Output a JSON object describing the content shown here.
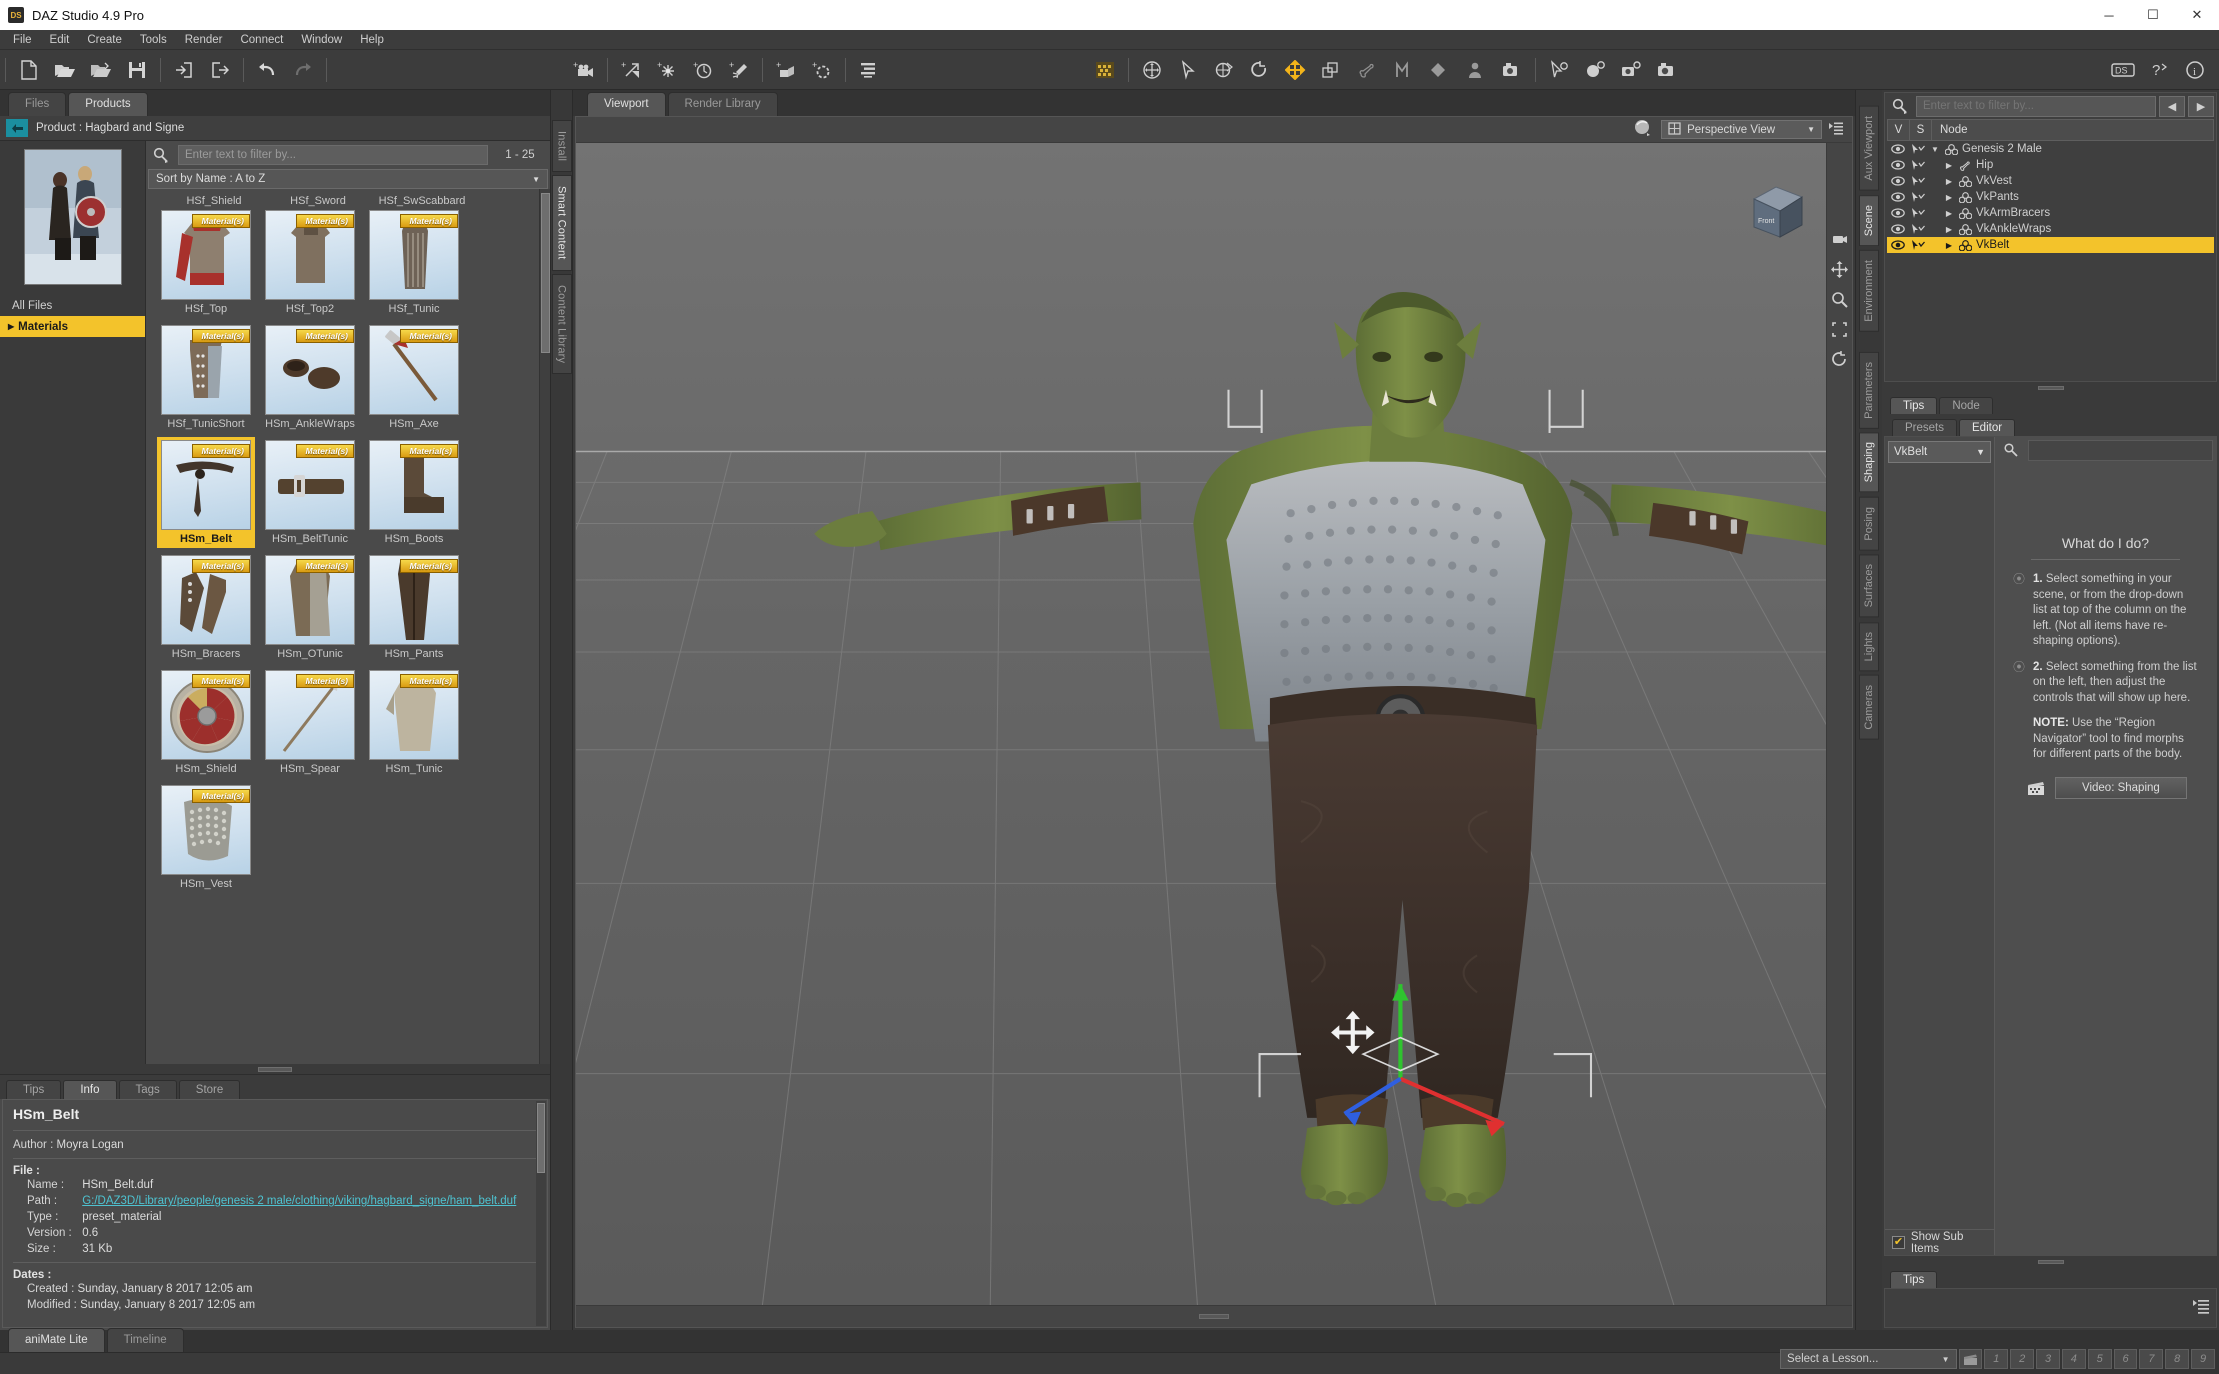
{
  "window": {
    "title": "DAZ Studio 4.9 Pro",
    "logo": "DS",
    "minimize": "─",
    "maximize": "☐",
    "close": "✕"
  },
  "menu": [
    "File",
    "Edit",
    "Create",
    "Tools",
    "Render",
    "Connect",
    "Window",
    "Help"
  ],
  "toolbar": {
    "left_icons": [
      "new-document-icon",
      "open-folder-icon",
      "open-recent-icon",
      "save-icon",
      "import-icon",
      "export-icon",
      "undo-icon",
      "redo-icon"
    ],
    "create_icons": [
      "add-camera-icon",
      "add-distant-light-icon",
      "add-point-light-icon",
      "add-spotlight-icon",
      "add-light-icon",
      "add-primitive-icon",
      "add-null-icon",
      "scene-list-icon"
    ],
    "tool_icons": [
      "texture-grid-icon",
      "universal-tool-icon",
      "node-selection-icon",
      "rotate-tool-icon",
      "translate-tool-icon",
      "active-pose-icon",
      "scale-tool-icon",
      "bone-tool-icon",
      "mesh-grabber-icon",
      "surface-selection-icon",
      "puppeteer-icon",
      "render-camera-icon",
      "cursor-settings-icon",
      "render-settings-icon",
      "camera-settings-icon",
      "render-icon"
    ],
    "right_icons": [
      "ds-connect-icon",
      "help-question-icon",
      "info-icon"
    ]
  },
  "left_panel": {
    "tabs": [
      {
        "label": "Files",
        "active": false
      },
      {
        "label": "Products",
        "active": true
      }
    ],
    "product_label": "Product :  Hagbard and Signe",
    "back_icon": "back-arrow-icon",
    "file_tree": [
      {
        "label": "All Files",
        "selected": false,
        "has_arrow": false
      },
      {
        "label": "Materials",
        "selected": true,
        "has_arrow": true
      }
    ],
    "filter_placeholder": "Enter text to filter by...",
    "page_count": "1 - 25",
    "sort_label": "Sort by Name : A to Z",
    "top_row_labels": [
      "HSf_Shield",
      "HSf_Sword",
      "HSf_SwScabbard"
    ],
    "items": [
      {
        "label": "HSf_Top",
        "badge": "Material(s)",
        "selected": false,
        "kind": "top-red"
      },
      {
        "label": "HSf_Top2",
        "badge": "Material(s)",
        "selected": false,
        "kind": "top-brown"
      },
      {
        "label": "HSf_Tunic",
        "badge": "Material(s)",
        "selected": false,
        "kind": "tunic"
      },
      {
        "label": "HSf_TunicShort",
        "badge": "Material(s)",
        "selected": false,
        "kind": "tunicshort"
      },
      {
        "label": "HSm_AnkleWraps",
        "badge": "Material(s)",
        "selected": false,
        "kind": "wraps"
      },
      {
        "label": "HSm_Axe",
        "badge": "Material(s)",
        "selected": false,
        "kind": "axe"
      },
      {
        "label": "HSm_Belt",
        "badge": "Material(s)",
        "selected": true,
        "kind": "belt"
      },
      {
        "label": "HSm_BeltTunic",
        "badge": "Material(s)",
        "selected": false,
        "kind": "belttunic"
      },
      {
        "label": "HSm_Boots",
        "badge": "Material(s)",
        "selected": false,
        "kind": "boots"
      },
      {
        "label": "HSm_Bracers",
        "badge": "Material(s)",
        "selected": false,
        "kind": "bracers"
      },
      {
        "label": "HSm_OTunic",
        "badge": "Material(s)",
        "selected": false,
        "kind": "otunic"
      },
      {
        "label": "HSm_Pants",
        "badge": "Material(s)",
        "selected": false,
        "kind": "pants"
      },
      {
        "label": "HSm_Shield",
        "badge": "Material(s)",
        "selected": false,
        "kind": "shield"
      },
      {
        "label": "HSm_Spear",
        "badge": "Material(s)",
        "selected": false,
        "kind": "spear"
      },
      {
        "label": "HSm_Tunic",
        "badge": "Material(s)",
        "selected": false,
        "kind": "mtunic"
      },
      {
        "label": "HSm_Vest",
        "badge": "Material(s)",
        "selected": false,
        "kind": "vest"
      }
    ]
  },
  "left_rail_tabs": [
    {
      "label": "Install",
      "active": false
    },
    {
      "label": "Smart Content",
      "active": true
    },
    {
      "label": "Content Library",
      "active": false
    }
  ],
  "info_panel": {
    "tabs": [
      {
        "label": "Tips",
        "active": false
      },
      {
        "label": "Info",
        "active": true
      },
      {
        "label": "Tags",
        "active": false
      },
      {
        "label": "Store",
        "active": false
      }
    ],
    "title": "HSm_Belt",
    "author_label": "Author :",
    "author_value": "Moyra Logan",
    "file_heading": "File :",
    "fields": [
      {
        "key": "Name :",
        "value": "HSm_Belt.duf",
        "link": false
      },
      {
        "key": "Path :",
        "value": "G:/DAZ3D/Library/people/genesis 2 male/clothing/viking/hagbard_signe/ham_belt.duf",
        "link": true
      },
      {
        "key": "Type :",
        "value": "preset_material",
        "link": false
      },
      {
        "key": "Version :",
        "value": "0.6",
        "link": false
      },
      {
        "key": "Size :",
        "value": "31 Kb",
        "link": false
      }
    ],
    "dates_heading": "Dates :",
    "dates": [
      {
        "key": "Created :",
        "value": "Sunday, January 8 2017 12:05 am"
      },
      {
        "key": "Modified :",
        "value": "Sunday, January 8 2017 12:05 am"
      }
    ]
  },
  "viewport": {
    "tabs": [
      {
        "label": "Viewport",
        "active": true
      },
      {
        "label": "Render Library",
        "active": false
      }
    ],
    "draw_style_icon": "sphere-shading-icon",
    "camera_icon": "camera-view-icon",
    "camera_label": "Perspective View",
    "menu_icon": "viewport-menu-icon",
    "nav_cube_label": "Front",
    "side_tools": [
      "camera-orbit-icon",
      "pan-view-icon",
      "zoom-view-icon",
      "frame-icon",
      "reset-view-icon"
    ],
    "model_description": "Orc character in T-pose wearing chainmail vest and dark pants"
  },
  "right_rail_tabs": [
    {
      "label": "Aux Viewport",
      "active": false
    },
    {
      "label": "Scene",
      "active": true
    },
    {
      "label": "Environment",
      "active": false
    },
    {
      "label": "Parameters",
      "active": false
    },
    {
      "label": "Shaping",
      "active": true
    },
    {
      "label": "Posing",
      "active": false
    },
    {
      "label": "Surfaces",
      "active": false
    },
    {
      "label": "Lights",
      "active": false
    },
    {
      "label": "Cameras",
      "active": false
    }
  ],
  "scene_panel": {
    "filter_placeholder": "Enter text to filter by...",
    "prev_icon": "arrow-left-icon",
    "next_icon": "arrow-right-icon",
    "columns": [
      "V",
      "S",
      "Node"
    ],
    "nodes": [
      {
        "label": "Genesis 2 Male",
        "indent": 0,
        "expanded": true,
        "icon": "figure-icon",
        "selected": false
      },
      {
        "label": "Hip",
        "indent": 1,
        "expanded": false,
        "icon": "bone-icon",
        "selected": false
      },
      {
        "label": "VkVest",
        "indent": 1,
        "expanded": false,
        "icon": "figure-icon",
        "selected": false
      },
      {
        "label": "VkPants",
        "indent": 1,
        "expanded": false,
        "icon": "figure-icon",
        "selected": false
      },
      {
        "label": "VkArmBracers",
        "indent": 1,
        "expanded": false,
        "icon": "figure-icon",
        "selected": false
      },
      {
        "label": "VkAnkleWraps",
        "indent": 1,
        "expanded": false,
        "icon": "figure-icon",
        "selected": false
      },
      {
        "label": "VkBelt",
        "indent": 1,
        "expanded": false,
        "icon": "figure-icon",
        "selected": true
      }
    ]
  },
  "tips_node_tabs": [
    {
      "label": "Tips",
      "active": true
    },
    {
      "label": "Node",
      "active": false
    }
  ],
  "shaping_panel": {
    "tabs": [
      {
        "label": "Presets",
        "active": false
      },
      {
        "label": "Editor",
        "active": true
      }
    ],
    "selector_value": "VkBelt",
    "search_placeholder": "",
    "help_title": "What do I do?",
    "steps": [
      {
        "num": "1.",
        "text": "Select something in your scene, or from the drop-down list at top of the column on the left. (Not all items have re-shaping options)."
      },
      {
        "num": "2.",
        "text": "Select something from the list on the left, then adjust the controls that will show up here."
      }
    ],
    "note_label": "NOTE:",
    "note_text": "Use the “Region Navigator” tool to find morphs for different parts of the body.",
    "video_button": "Video: Shaping",
    "video_icon": "film-clapper-icon",
    "show_sub_items": "Show Sub Items",
    "show_sub_items_checked": true
  },
  "bottom_right_tips": {
    "tabs": [
      {
        "label": "Tips",
        "active": true
      }
    ],
    "icon": "tips-list-icon"
  },
  "bottom_bar": {
    "tabs": [
      {
        "label": "aniMate Lite",
        "active": true
      },
      {
        "label": "Timeline",
        "active": false
      }
    ],
    "lesson_placeholder": "Select a Lesson...",
    "lesson_icon": "film-clapper-icon",
    "lesson_buttons": [
      "1",
      "2",
      "3",
      "4",
      "5",
      "6",
      "7",
      "8",
      "9"
    ]
  },
  "colors": {
    "accent_selected": "#f3c32b",
    "link": "#4ec3d1",
    "panel_bg": "#3a3a3a",
    "teal_button": "#1b8fa0"
  }
}
